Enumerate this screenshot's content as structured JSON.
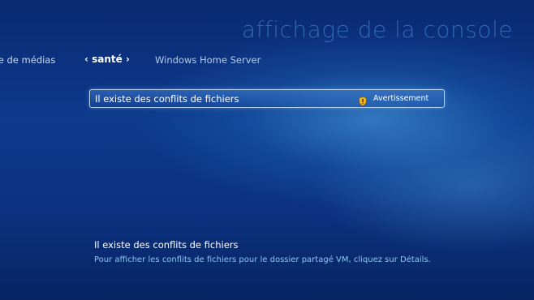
{
  "page": {
    "title": "affichage de la console"
  },
  "nav": {
    "prev_label": "bre de médias",
    "current_label": "santé",
    "current_left_chevron": "‹",
    "current_right_chevron": "›",
    "next_label": "Windows Home Server"
  },
  "list": {
    "items": [
      {
        "label": "Il existe des conflits de fichiers",
        "status": "Avertissement",
        "icon": "shield-warning-icon"
      }
    ]
  },
  "details": {
    "title": "Il existe des conflits de fichiers",
    "description": "Pour afficher les conflits de fichiers pour le dossier partagé  VM, cliquez sur Détails."
  },
  "colors": {
    "background": "#0d3a8c",
    "title_text": "#4f8fd9",
    "description_text": "#8fc6f2",
    "warning_icon": "#f2b320"
  }
}
